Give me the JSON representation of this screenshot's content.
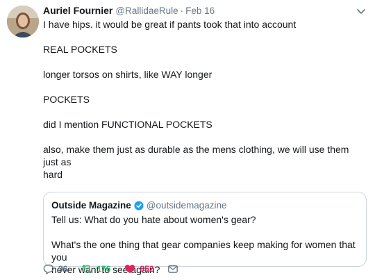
{
  "tweet": {
    "name": "Auriel Fournier",
    "handle": "@RallidaeRule",
    "separator": "·",
    "date": "Feb 16",
    "lines": [
      "I have hips. it would be great if pants took that into account",
      "REAL POCKETS",
      "longer torsos on shirts, like WAY longer",
      "POCKETS",
      "did I mention FUNCTIONAL POCKETS",
      "also, make them just as durable as the mens clothing, we will use them just as",
      "hard"
    ]
  },
  "quote": {
    "name": "Outside Magazine",
    "handle": "@outsidemagazine",
    "lines": [
      "Tell us: What do you hate about women's gear?",
      "What's the one thing that gear companies keep making for women that you",
      "never want to see again?"
    ]
  },
  "actions": {
    "replies": "36",
    "retweets": "176",
    "likes": "852"
  },
  "icons": {
    "reply": "reply-icon",
    "retweet": "retweet-icon",
    "like": "heart-icon",
    "dm": "envelope-icon",
    "caret": "chevron-down-icon",
    "verified": "verified-badge-icon"
  },
  "colors": {
    "retweet": "#17bf63",
    "like": "#e0245e",
    "muted": "#657786",
    "verified": "#1da1f2"
  }
}
